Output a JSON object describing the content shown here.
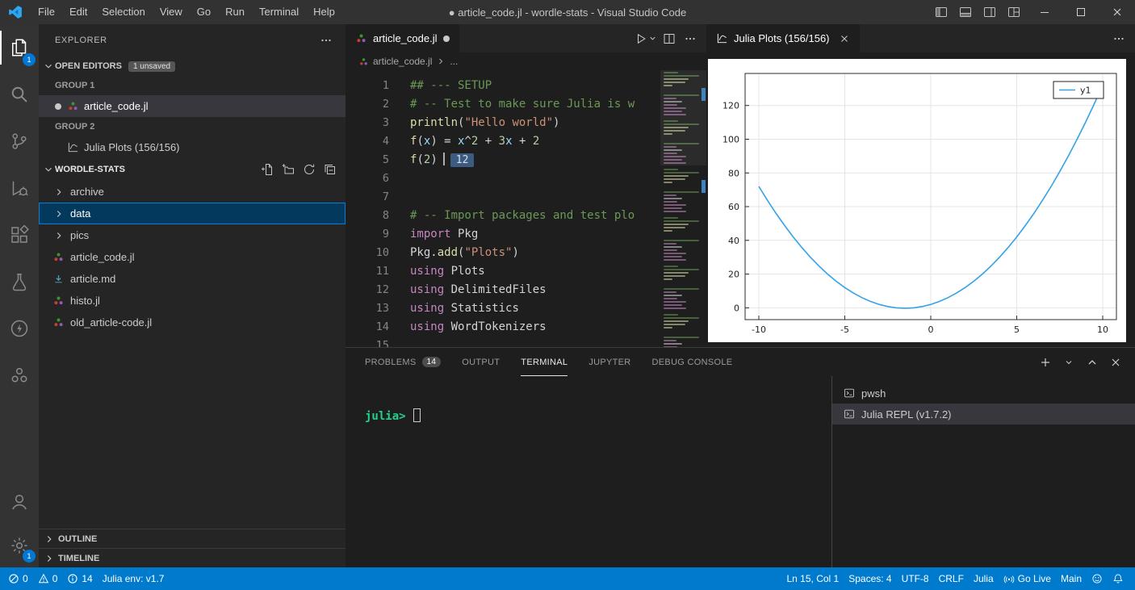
{
  "window": {
    "title": "● article_code.jl - wordle-stats - Visual Studio Code",
    "menus": [
      "File",
      "Edit",
      "Selection",
      "View",
      "Go",
      "Run",
      "Terminal",
      "Help"
    ]
  },
  "activity_bar": {
    "top": [
      {
        "icon": "explorer",
        "badge": "1",
        "active": true
      },
      {
        "icon": "search",
        "active": false
      },
      {
        "icon": "source-control",
        "active": false
      },
      {
        "icon": "run-debug",
        "active": false
      },
      {
        "icon": "extensions",
        "active": false
      },
      {
        "icon": "testing",
        "active": false
      },
      {
        "icon": "thunder",
        "active": false
      },
      {
        "icon": "julia",
        "active": false
      }
    ],
    "bottom": [
      {
        "icon": "account",
        "active": false
      },
      {
        "icon": "settings",
        "badge": "1",
        "active": false
      }
    ]
  },
  "sidebar": {
    "title": "EXPLORER",
    "open_editors": {
      "label": "OPEN EDITORS",
      "badge": "1 unsaved",
      "groups": [
        {
          "label": "GROUP 1",
          "items": [
            {
              "name": "article_code.jl",
              "icon": "julia-file",
              "modified": true,
              "active": true
            }
          ]
        },
        {
          "label": "GROUP 2",
          "items": [
            {
              "name": "Julia Plots (156/156)",
              "icon": "plot-pane",
              "modified": false,
              "active": false
            }
          ]
        }
      ]
    },
    "workspace": {
      "label": "WORDLE-STATS",
      "tree": [
        {
          "name": "archive",
          "type": "folder",
          "selected": false
        },
        {
          "name": "data",
          "type": "folder",
          "selected": true
        },
        {
          "name": "pics",
          "type": "folder",
          "selected": false
        },
        {
          "name": "article_code.jl",
          "type": "julia",
          "selected": false
        },
        {
          "name": "article.md",
          "type": "markdown",
          "selected": false
        },
        {
          "name": "histo.jl",
          "type": "julia",
          "selected": false
        },
        {
          "name": "old_article-code.jl",
          "type": "julia",
          "selected": false
        }
      ]
    },
    "bottom_sections": [
      "OUTLINE",
      "TIMELINE"
    ]
  },
  "editor": {
    "tab": {
      "title": "article_code.jl",
      "modified": true
    },
    "breadcrumb": [
      "article_code.jl",
      "..."
    ],
    "lines": [
      {
        "n": "1",
        "seg": [
          [
            "cm",
            "## --- SETUP"
          ]
        ]
      },
      {
        "n": "2",
        "seg": [
          [
            "cm",
            "# -- Test to make sure Julia is w"
          ]
        ]
      },
      {
        "n": "3",
        "seg": [
          [
            "fn",
            "println"
          ],
          [
            "pl",
            "("
          ],
          [
            "str",
            "\"Hello world\""
          ],
          [
            "pl",
            ")"
          ]
        ]
      },
      {
        "n": "4",
        "seg": [
          [
            "fn",
            "f"
          ],
          [
            "pl",
            "("
          ],
          [
            "var",
            "x"
          ],
          [
            "pl",
            ") = "
          ],
          [
            "var",
            "x"
          ],
          [
            "pl",
            "^"
          ],
          [
            "num",
            "2"
          ],
          [
            "pl",
            " + "
          ],
          [
            "num",
            "3"
          ],
          [
            "var",
            "x"
          ],
          [
            "pl",
            " + "
          ],
          [
            "num",
            "2"
          ]
        ]
      },
      {
        "n": "5",
        "seg": [
          [
            "fn",
            "f"
          ],
          [
            "pl",
            "("
          ],
          [
            "num",
            "2"
          ],
          [
            "pl",
            ")"
          ],
          [
            "cursor",
            ""
          ],
          [
            "result",
            "12"
          ]
        ]
      },
      {
        "n": "6",
        "seg": []
      },
      {
        "n": "7",
        "seg": []
      },
      {
        "n": "8",
        "seg": [
          [
            "cm",
            "# -- Import packages and test plo"
          ]
        ]
      },
      {
        "n": "9",
        "seg": [
          [
            "kw",
            "import"
          ],
          [
            "pl",
            " Pkg"
          ]
        ]
      },
      {
        "n": "10",
        "seg": [
          [
            "pl",
            "Pkg."
          ],
          [
            "fn",
            "add"
          ],
          [
            "pl",
            "("
          ],
          [
            "str",
            "\"Plots\""
          ],
          [
            "pl",
            ")"
          ]
        ]
      },
      {
        "n": "11",
        "seg": [
          [
            "kw",
            "using"
          ],
          [
            "pl",
            " Plots"
          ]
        ]
      },
      {
        "n": "12",
        "seg": [
          [
            "kw",
            "using"
          ],
          [
            "pl",
            " DelimitedFiles"
          ]
        ]
      },
      {
        "n": "13",
        "seg": [
          [
            "kw",
            "using"
          ],
          [
            "pl",
            " Statistics"
          ]
        ]
      },
      {
        "n": "14",
        "seg": [
          [
            "kw",
            "using"
          ],
          [
            "pl",
            " WordTokenizers"
          ]
        ]
      },
      {
        "n": "15",
        "seg": []
      }
    ]
  },
  "plot_pane": {
    "tab_title": "Julia Plots (156/156)"
  },
  "chart_data": {
    "type": "line",
    "title": "",
    "xlabel": "",
    "ylabel": "",
    "xlim": [
      -10.8,
      10.8
    ],
    "ylim": [
      -7,
      139
    ],
    "xticks": [
      -10,
      -5,
      0,
      5,
      10
    ],
    "yticks": [
      0,
      20,
      40,
      60,
      80,
      100,
      120
    ],
    "grid": true,
    "legend": {
      "position": "top-right",
      "entries": [
        "y1"
      ]
    },
    "series": [
      {
        "name": "y1",
        "color": "#35a2e8",
        "x": [
          -10,
          -9.5,
          -9,
          -8.5,
          -8,
          -7.5,
          -7,
          -6.5,
          -6,
          -5.5,
          -5,
          -4.5,
          -4,
          -3.5,
          -3,
          -2.5,
          -2,
          -1.5,
          -1,
          -0.5,
          0,
          0.5,
          1,
          1.5,
          2,
          2.5,
          3,
          3.5,
          4,
          4.5,
          5,
          5.5,
          6,
          6.5,
          7,
          7.5,
          8,
          8.5,
          9,
          9.5,
          10
        ],
        "y": [
          72,
          63.75,
          56,
          48.75,
          42,
          35.75,
          30,
          24.75,
          20,
          15.75,
          12,
          8.75,
          6,
          3.75,
          2,
          0.75,
          0,
          -0.25,
          0,
          0.75,
          2,
          3.75,
          6,
          8.75,
          12,
          15.75,
          20,
          24.75,
          30,
          35.75,
          42,
          48.75,
          56,
          63.75,
          72,
          80.75,
          90,
          99.75,
          110,
          120.75,
          132
        ]
      }
    ]
  },
  "panel": {
    "tabs": [
      {
        "label": "PROBLEMS",
        "badge": "14",
        "active": false
      },
      {
        "label": "OUTPUT",
        "active": false
      },
      {
        "label": "TERMINAL",
        "active": true
      },
      {
        "label": "JUPYTER",
        "active": false
      },
      {
        "label": "DEBUG CONSOLE",
        "active": false
      }
    ],
    "terminal": {
      "prompt": "julia>"
    },
    "terminal_list": [
      {
        "label": "pwsh",
        "selected": false
      },
      {
        "label": "Julia REPL (v1.7.2)",
        "selected": true
      }
    ]
  },
  "status_bar": {
    "left": [
      {
        "icon": "error",
        "text": "0"
      },
      {
        "icon": "warning",
        "text": "0"
      },
      {
        "icon": "info",
        "text": "14"
      },
      {
        "text": "Julia env: v1.7"
      }
    ],
    "right": [
      {
        "text": "Ln 15, Col 1"
      },
      {
        "text": "Spaces: 4"
      },
      {
        "text": "UTF-8"
      },
      {
        "text": "CRLF"
      },
      {
        "text": "Julia"
      },
      {
        "icon": "broadcast",
        "text": "Go Live"
      },
      {
        "text": "Main"
      },
      {
        "icon": "feedback"
      },
      {
        "icon": "bell"
      }
    ]
  }
}
